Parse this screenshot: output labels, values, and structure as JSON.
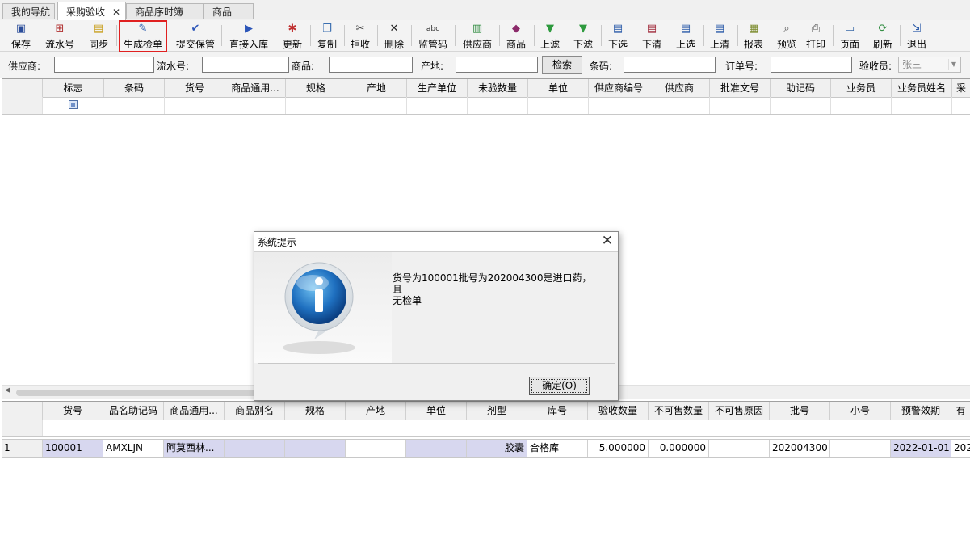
{
  "tabs": [
    {
      "label": "我的导航"
    },
    {
      "label": "采购验收"
    },
    {
      "label": "商品序时簿"
    },
    {
      "label": "商品"
    }
  ],
  "toolbar": [
    {
      "label": "保存",
      "icon": "save-icon"
    },
    {
      "label": "流水号",
      "icon": "serial-icon"
    },
    {
      "label": "同步",
      "icon": "sync-icon"
    },
    {
      "label": "生成检单",
      "icon": "generate-icon"
    },
    {
      "label": "提交保管",
      "icon": "check-icon"
    },
    {
      "label": "直接入库",
      "icon": "play-icon"
    },
    {
      "label": "更新",
      "icon": "update-icon"
    },
    {
      "label": "复制",
      "icon": "copy-icon"
    },
    {
      "label": "拒收",
      "icon": "reject-icon"
    },
    {
      "label": "删除",
      "icon": "delete-icon"
    },
    {
      "label": "监管码",
      "icon": "abc-icon"
    },
    {
      "label": "供应商",
      "icon": "supplier-icon"
    },
    {
      "label": "商品",
      "icon": "book-icon"
    },
    {
      "label": "上滤",
      "icon": "filter-icon"
    },
    {
      "label": "下滤",
      "icon": "filter-icon"
    },
    {
      "label": "下选",
      "icon": "select-icon"
    },
    {
      "label": "下清",
      "icon": "clear-icon"
    },
    {
      "label": "上选",
      "icon": "select-icon"
    },
    {
      "label": "上清",
      "icon": "clear-icon"
    },
    {
      "label": "报表",
      "icon": "report-icon"
    },
    {
      "label": "预览",
      "icon": "preview-icon"
    },
    {
      "label": "打印",
      "icon": "print-icon"
    },
    {
      "label": "页面",
      "icon": "page-icon"
    },
    {
      "label": "刷新",
      "icon": "refresh-icon"
    },
    {
      "label": "退出",
      "icon": "exit-icon"
    }
  ],
  "filter": {
    "supplier_label": "供应商:",
    "serial_label": "流水号:",
    "product_label": "商品:",
    "origin_label": "产地:",
    "search_button": "检索",
    "barcode_label": "条码:",
    "order_label": "订单号:",
    "inspector_label": "验收员:",
    "inspector_value": "张三"
  },
  "top_grid": {
    "columns": [
      "标志",
      "条码",
      "货号",
      "商品通用...",
      "规格",
      "产地",
      "生产单位",
      "未验数量",
      "单位",
      "供应商编号",
      "供应商",
      "批准文号",
      "助记码",
      "业务员",
      "业务员姓名",
      "采"
    ]
  },
  "bottom_grid": {
    "columns": [
      "货号",
      "品名助记码",
      "商品通用...",
      "商品别名",
      "规格",
      "产地",
      "单位",
      "剂型",
      "库号",
      "验收数量",
      "不可售数量",
      "不可售原因",
      "批号",
      "小号",
      "预警效期",
      "有"
    ],
    "rows": [
      {
        "index": "1",
        "cells": [
          "100001",
          "AMXLJN",
          "阿莫西林...",
          "",
          "",
          "",
          "",
          "胶囊",
          "合格库",
          "5.000000",
          "0.000000",
          "",
          "202004300",
          "",
          "2022-01-01",
          "202"
        ]
      }
    ]
  },
  "dialog": {
    "title": "系统提示",
    "message_line1": "货号为100001批号为202004300是进口药，且",
    "message_line2": "无检单",
    "ok_label": "确定(O)"
  }
}
